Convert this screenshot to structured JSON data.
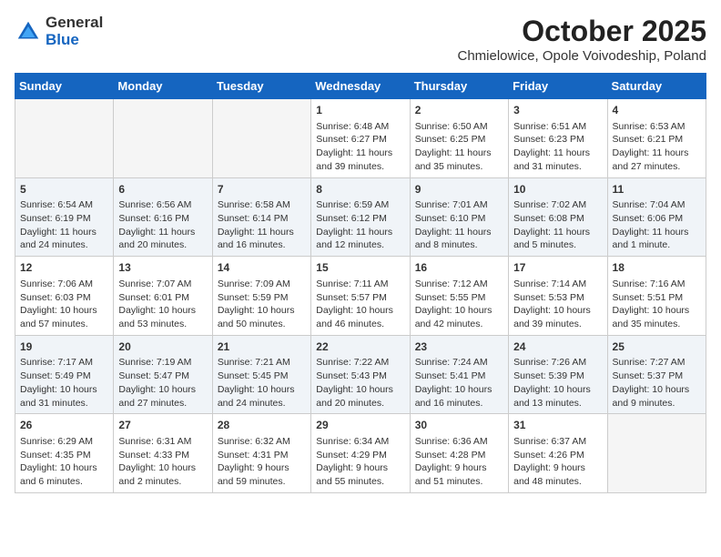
{
  "header": {
    "logo_general": "General",
    "logo_blue": "Blue",
    "month_title": "October 2025",
    "subtitle": "Chmielowice, Opole Voivodeship, Poland"
  },
  "weekdays": [
    "Sunday",
    "Monday",
    "Tuesday",
    "Wednesday",
    "Thursday",
    "Friday",
    "Saturday"
  ],
  "weeks": [
    [
      {
        "day": "",
        "info": ""
      },
      {
        "day": "",
        "info": ""
      },
      {
        "day": "",
        "info": ""
      },
      {
        "day": "1",
        "info": "Sunrise: 6:48 AM\nSunset: 6:27 PM\nDaylight: 11 hours\nand 39 minutes."
      },
      {
        "day": "2",
        "info": "Sunrise: 6:50 AM\nSunset: 6:25 PM\nDaylight: 11 hours\nand 35 minutes."
      },
      {
        "day": "3",
        "info": "Sunrise: 6:51 AM\nSunset: 6:23 PM\nDaylight: 11 hours\nand 31 minutes."
      },
      {
        "day": "4",
        "info": "Sunrise: 6:53 AM\nSunset: 6:21 PM\nDaylight: 11 hours\nand 27 minutes."
      }
    ],
    [
      {
        "day": "5",
        "info": "Sunrise: 6:54 AM\nSunset: 6:19 PM\nDaylight: 11 hours\nand 24 minutes."
      },
      {
        "day": "6",
        "info": "Sunrise: 6:56 AM\nSunset: 6:16 PM\nDaylight: 11 hours\nand 20 minutes."
      },
      {
        "day": "7",
        "info": "Sunrise: 6:58 AM\nSunset: 6:14 PM\nDaylight: 11 hours\nand 16 minutes."
      },
      {
        "day": "8",
        "info": "Sunrise: 6:59 AM\nSunset: 6:12 PM\nDaylight: 11 hours\nand 12 minutes."
      },
      {
        "day": "9",
        "info": "Sunrise: 7:01 AM\nSunset: 6:10 PM\nDaylight: 11 hours\nand 8 minutes."
      },
      {
        "day": "10",
        "info": "Sunrise: 7:02 AM\nSunset: 6:08 PM\nDaylight: 11 hours\nand 5 minutes."
      },
      {
        "day": "11",
        "info": "Sunrise: 7:04 AM\nSunset: 6:06 PM\nDaylight: 11 hours\nand 1 minute."
      }
    ],
    [
      {
        "day": "12",
        "info": "Sunrise: 7:06 AM\nSunset: 6:03 PM\nDaylight: 10 hours\nand 57 minutes."
      },
      {
        "day": "13",
        "info": "Sunrise: 7:07 AM\nSunset: 6:01 PM\nDaylight: 10 hours\nand 53 minutes."
      },
      {
        "day": "14",
        "info": "Sunrise: 7:09 AM\nSunset: 5:59 PM\nDaylight: 10 hours\nand 50 minutes."
      },
      {
        "day": "15",
        "info": "Sunrise: 7:11 AM\nSunset: 5:57 PM\nDaylight: 10 hours\nand 46 minutes."
      },
      {
        "day": "16",
        "info": "Sunrise: 7:12 AM\nSunset: 5:55 PM\nDaylight: 10 hours\nand 42 minutes."
      },
      {
        "day": "17",
        "info": "Sunrise: 7:14 AM\nSunset: 5:53 PM\nDaylight: 10 hours\nand 39 minutes."
      },
      {
        "day": "18",
        "info": "Sunrise: 7:16 AM\nSunset: 5:51 PM\nDaylight: 10 hours\nand 35 minutes."
      }
    ],
    [
      {
        "day": "19",
        "info": "Sunrise: 7:17 AM\nSunset: 5:49 PM\nDaylight: 10 hours\nand 31 minutes."
      },
      {
        "day": "20",
        "info": "Sunrise: 7:19 AM\nSunset: 5:47 PM\nDaylight: 10 hours\nand 27 minutes."
      },
      {
        "day": "21",
        "info": "Sunrise: 7:21 AM\nSunset: 5:45 PM\nDaylight: 10 hours\nand 24 minutes."
      },
      {
        "day": "22",
        "info": "Sunrise: 7:22 AM\nSunset: 5:43 PM\nDaylight: 10 hours\nand 20 minutes."
      },
      {
        "day": "23",
        "info": "Sunrise: 7:24 AM\nSunset: 5:41 PM\nDaylight: 10 hours\nand 16 minutes."
      },
      {
        "day": "24",
        "info": "Sunrise: 7:26 AM\nSunset: 5:39 PM\nDaylight: 10 hours\nand 13 minutes."
      },
      {
        "day": "25",
        "info": "Sunrise: 7:27 AM\nSunset: 5:37 PM\nDaylight: 10 hours\nand 9 minutes."
      }
    ],
    [
      {
        "day": "26",
        "info": "Sunrise: 6:29 AM\nSunset: 4:35 PM\nDaylight: 10 hours\nand 6 minutes."
      },
      {
        "day": "27",
        "info": "Sunrise: 6:31 AM\nSunset: 4:33 PM\nDaylight: 10 hours\nand 2 minutes."
      },
      {
        "day": "28",
        "info": "Sunrise: 6:32 AM\nSunset: 4:31 PM\nDaylight: 9 hours\nand 59 minutes."
      },
      {
        "day": "29",
        "info": "Sunrise: 6:34 AM\nSunset: 4:29 PM\nDaylight: 9 hours\nand 55 minutes."
      },
      {
        "day": "30",
        "info": "Sunrise: 6:36 AM\nSunset: 4:28 PM\nDaylight: 9 hours\nand 51 minutes."
      },
      {
        "day": "31",
        "info": "Sunrise: 6:37 AM\nSunset: 4:26 PM\nDaylight: 9 hours\nand 48 minutes."
      },
      {
        "day": "",
        "info": ""
      }
    ]
  ]
}
